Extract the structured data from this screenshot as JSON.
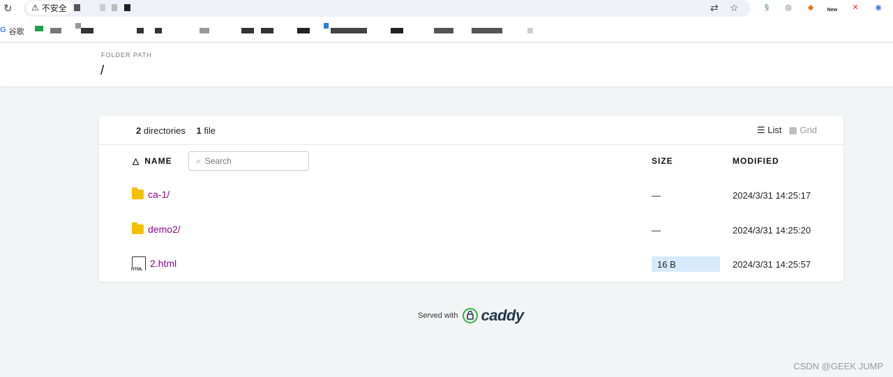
{
  "browser": {
    "security_label": "不安全",
    "bookmark_google": "谷歌",
    "ext_new_label": "New"
  },
  "header": {
    "folder_label": "FOLDER PATH",
    "path": "/"
  },
  "summary": {
    "dir_count": "2",
    "dir_label": "directories",
    "file_count": "1",
    "file_label": "file"
  },
  "view": {
    "list_label": "List",
    "grid_label": "Grid"
  },
  "table": {
    "col_name": "NAME",
    "col_size": "SIZE",
    "col_modified": "MODIFIED",
    "search_placeholder": "Search",
    "rows": [
      {
        "name": "ca-1/",
        "size": "—",
        "modified": "2024/3/31 14:25:17",
        "type": "folder"
      },
      {
        "name": "demo2/",
        "size": "—",
        "modified": "2024/3/31 14:25:20",
        "type": "folder"
      },
      {
        "name": "2.html",
        "size": "16 B",
        "modified": "2024/3/31 14:25:57",
        "type": "html"
      }
    ]
  },
  "footer": {
    "served_with": "Served with",
    "brand": "caddy"
  },
  "watermark": "CSDN @GEEK JUMP",
  "icons": {
    "reload": "reload-icon",
    "warning": "warning-icon",
    "translate": "translate-icon",
    "star": "star-icon",
    "sort": "sort-triangle-icon",
    "search": "search-icon",
    "folder": "folder-icon",
    "html": "html-file-icon",
    "list": "list-icon",
    "grid": "grid-icon"
  },
  "colors": {
    "link": "#8a0a8a",
    "folder": "#f6c000",
    "size_highlight": "#d6eafb"
  }
}
